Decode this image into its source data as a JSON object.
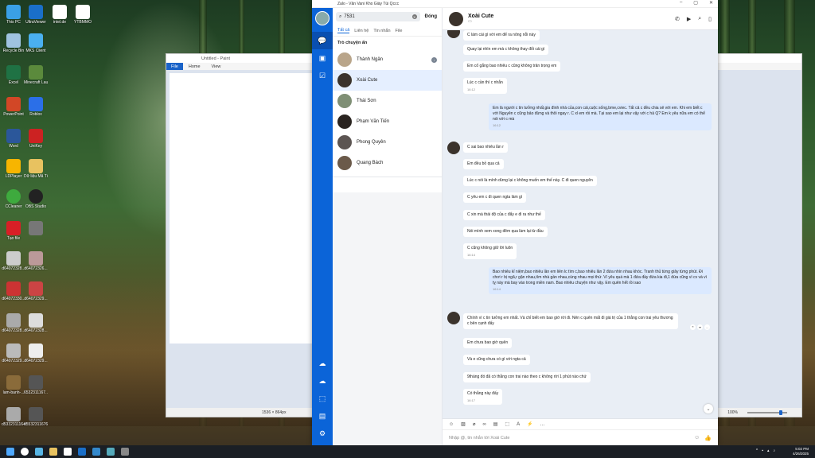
{
  "desktop": {
    "icons": [
      "This PC",
      "UltraViewer",
      "intel.de",
      "YTBMMO",
      "Recycle Bin",
      "MKS Client",
      "Excel",
      "Minecraft Launcher",
      "PowerPoint",
      "Roblox",
      "Word",
      "UniKey",
      "LDPlayer",
      "Dữ liệu Mã Tội Thàn Mxx",
      "CCleaner",
      "OBS Studio",
      "Tạo file",
      "",
      "d64072328...",
      "d64072326...",
      "d64072330...",
      "d64072329...",
      "d64072328...",
      "d64072328...",
      "d64072329...",
      "d64072329...",
      "lam-banh-...",
      "6532311167...",
      "d5332311164...",
      "d5532311676..."
    ]
  },
  "paint": {
    "title": "Untitled - Paint",
    "menu_file": "File",
    "menu_home": "Home",
    "menu_view": "View",
    "status_size": "1536 × 864px",
    "zoom": "100%"
  },
  "zalo": {
    "window_title": "Zalo - Văn Vani Kho Giày Túi Qccc",
    "search_value": "7531",
    "close_label": "Đóng",
    "tabs": [
      "Tất cả",
      "Liên hệ",
      "Tin nhắn",
      "File"
    ],
    "section_title": "Trò chuyện ẩn",
    "contacts": [
      "Thành Ngân",
      "Xoài Cute",
      "Thái Sơn",
      "Phạm Văn Tiến",
      "Phong Quyên",
      "Quang Bách"
    ],
    "chat_name": "Xoài Cute",
    "messages": {
      "m1": "C làm cái gì với em để ra nông nỗi này",
      "m2": "Quay lại nhìn em mà c không thay đổi cái gì",
      "m3": "Em cố gắng bao nhiêu c cũng không trân trọng em",
      "m4": "Lúc c cần thì c nhắn",
      "t4": "16:12",
      "o1": "Em là người c tin tưởng nhất,gia đình nhà của,con cái,cuộc sống,bme,cviec. Tất cả c đều chia sẻ với em. Khi em biết c với Nguyên c cũng bảo đừng và thôi ngay r. C xl em rồi mà. Tại sao em lại như vậy với c hả Q? Em k yêu nữa em có thể nói với c mà",
      "to1": "16:12",
      "m5": "C sai bao nhiêu lần r",
      "m6": "Em đều bỏ qua cả",
      "m7": "Lúc c nói là mình dừng lại c không muốn em thế này. C đi quen nguyên",
      "m8": "C yêu em c đi quen ngta làm gì",
      "m9": "C xin mà thái độ của c đẩy e đi ra như thế",
      "m10": "Nói mình xem xong đêm qua làm lại từ đầu",
      "m11": "C cũng không giữ lời luôn",
      "t11": "16:14",
      "o2": "Bao nhiêu kỉ niệm,bao nhiêu lần em liên lc tìm c,bao nhiêu lần 2 đứa nhìn nhau khóc. Tranh thủ từng giây từng phút. Đi chơi r bị ngã,r gặn nhau,tìm nhà gần nhau,cùng nhau mọi thứ. Vì yêu quá mà 1 đứa đầy đứa kia đi,1 đứa cũng vì cv và vì tỵ này mà bay vào trong miền nam. Bao nhiêu chuyện như vậy. Em quên hết rồi sao",
      "to2": "16:14",
      "m12": "Chính vì c tin tưởng em nhất. Và chỉ biết em bao giờ rời đi. Nên c quên mất đi giá trị của 1 thằng con trai yêu thương c bên cạnh đấy",
      "m13": "Em chưa bao giờ quên",
      "m14": "Và e cũng chưa có gì với ngta cả",
      "m15": "9tháng đó đã có thằng con trai nào theo c không rời 1 phút nào chứ",
      "m16": "Có thằng này đấy",
      "t16": "16:17"
    },
    "input_placeholder": "Nhập @, tin nhắn tới Xoài Cute"
  },
  "taskbar": {
    "time": "5:02 PM",
    "date": "4/26/2025"
  }
}
